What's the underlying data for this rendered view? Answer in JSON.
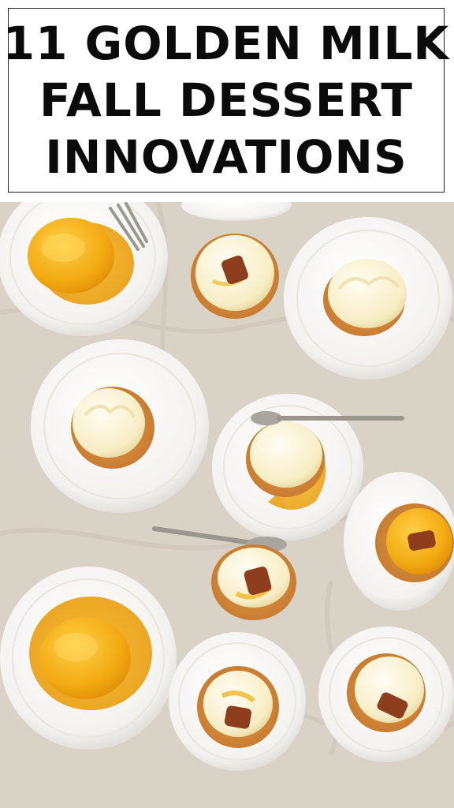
{
  "title": {
    "line1": "11 GOLDEN MILK",
    "line2": "FALL DESSERT",
    "line3": "INNOVATIONS"
  },
  "photo": {
    "subject": "golden-milk-desserts-flatlay",
    "colors": {
      "cloth": "#d8d1c6",
      "plate": "#f6f5f2",
      "cream": "#fbf3d8",
      "custard": "#f2b21b",
      "cake": "#d58a3a",
      "pecan": "#8e3e1d"
    }
  }
}
